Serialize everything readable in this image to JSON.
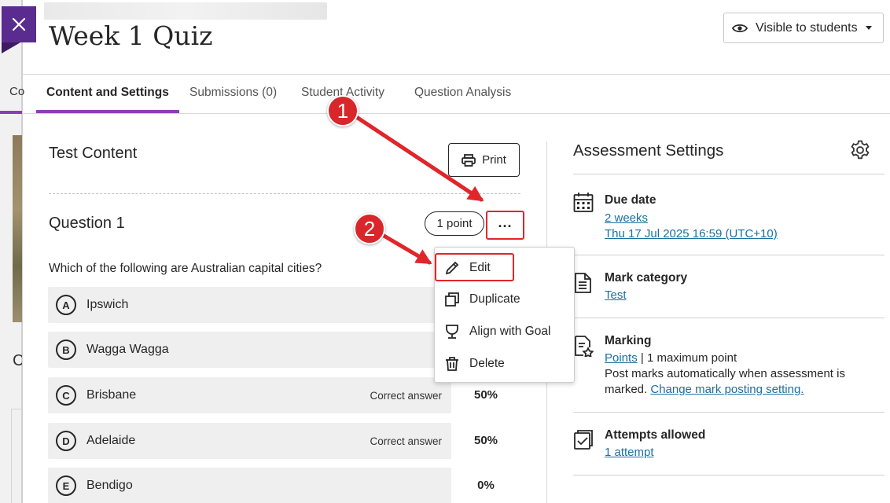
{
  "background_page": {
    "tab_fragment": "Co",
    "heading_fragment": "C"
  },
  "header": {
    "title": "Week 1 Quiz",
    "visibility_label": "Visible to students"
  },
  "tabs": [
    {
      "label": "Content and Settings",
      "active": true
    },
    {
      "label": "Submissions (0)",
      "active": false
    },
    {
      "label": "Student Activity",
      "active": false
    },
    {
      "label": "Question Analysis",
      "active": false
    }
  ],
  "test_content": {
    "title": "Test Content",
    "print_label": "Print"
  },
  "question": {
    "title": "Question 1",
    "points": "1 point",
    "more_label": "...",
    "text": "Which of the following are Australian capital cities?",
    "answers": [
      {
        "letter": "A",
        "text": "Ipswich",
        "correct_label": "",
        "percent": ""
      },
      {
        "letter": "B",
        "text": "Wagga Wagga",
        "correct_label": "",
        "percent": ""
      },
      {
        "letter": "C",
        "text": "Brisbane",
        "correct_label": "Correct answer",
        "percent": "50%"
      },
      {
        "letter": "D",
        "text": "Adelaide",
        "correct_label": "Correct answer",
        "percent": "50%"
      },
      {
        "letter": "E",
        "text": "Bendigo",
        "correct_label": "",
        "percent": "0%"
      }
    ]
  },
  "menu": {
    "items": [
      {
        "label": "Edit",
        "icon": "pencil-icon"
      },
      {
        "label": "Duplicate",
        "icon": "duplicate-icon"
      },
      {
        "label": "Align with Goal",
        "icon": "goal-icon"
      },
      {
        "label": "Delete",
        "icon": "trash-icon"
      }
    ]
  },
  "assessment_settings": {
    "title": "Assessment Settings",
    "due_date": {
      "label": "Due date",
      "relative": "2 weeks",
      "date": "Thu 17 Jul 2025 16:59 (UTC+10)"
    },
    "mark_category": {
      "label": "Mark category",
      "value": "Test"
    },
    "marking": {
      "label": "Marking",
      "points_link": "Points",
      "separator": " | ",
      "max_points": "1 maximum point",
      "post_text_1": "Post marks automatically when assessment is",
      "post_text_2": "marked. ",
      "change_link": "Change mark posting setting."
    },
    "attempts": {
      "label": "Attempts allowed",
      "value": "1 attempt"
    }
  },
  "annotations": {
    "step1": "1",
    "step2": "2"
  },
  "colors": {
    "accent_purple": "#8a3fb5",
    "close_purple": "#5b2c8f",
    "annotation_red": "#e0262a",
    "link_blue": "#1a6fa0"
  }
}
